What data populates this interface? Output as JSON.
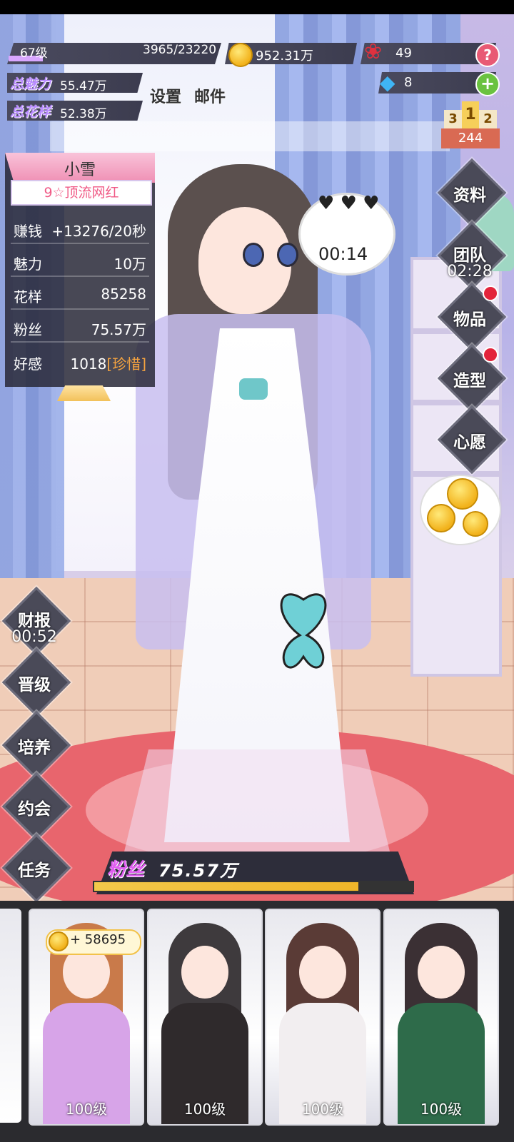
{
  "hud": {
    "level": "67级",
    "exp": "3965/23220",
    "exp_progress": 0.17,
    "coins": "952.31万",
    "roses": "49",
    "gems": "8",
    "help_icon": "?",
    "plus_icon": "+",
    "charm_label": "总魅力",
    "charm_value": "55.47万",
    "style_label": "总花样",
    "style_value": "52.38万",
    "settings_label": "设置",
    "mail_label": "邮件"
  },
  "ranking": {
    "first": "1",
    "second": "2",
    "third": "3",
    "value": "244"
  },
  "info": {
    "name": "小雪",
    "title": "9☆顶流网红",
    "rows": [
      {
        "key": "赚钱",
        "value": "+13276/20秒"
      },
      {
        "key": "魅力",
        "value": "10万"
      },
      {
        "key": "花样",
        "value": "85258"
      },
      {
        "key": "粉丝",
        "value": "75.57万"
      }
    ],
    "affinity_key": "好感",
    "affinity_value": "1018",
    "affinity_tag": "[珍惜]"
  },
  "bubble": {
    "time": "00:14"
  },
  "right_menu": {
    "profile": "资料",
    "team": "团队",
    "team_timer": "02:28",
    "items": "物品",
    "styling": "造型",
    "wish": "心愿"
  },
  "left_menu": {
    "finance": "财报",
    "finance_timer": "00:52",
    "promote": "晋级",
    "train": "培养",
    "date": "约会",
    "task": "任务"
  },
  "fans": {
    "label": "粉丝",
    "value": "75.57万",
    "progress": 0.83
  },
  "cards": {
    "earn": "+ 58695",
    "levels": [
      "100级",
      "100级",
      "100级",
      "100级"
    ]
  },
  "colors": {
    "accent_pink": "#ef8fb4",
    "charm_purple": "#b98cff",
    "hud_dark": "#3c3c4f",
    "gold": "#f2b21b",
    "alert_red": "#e3243b"
  }
}
